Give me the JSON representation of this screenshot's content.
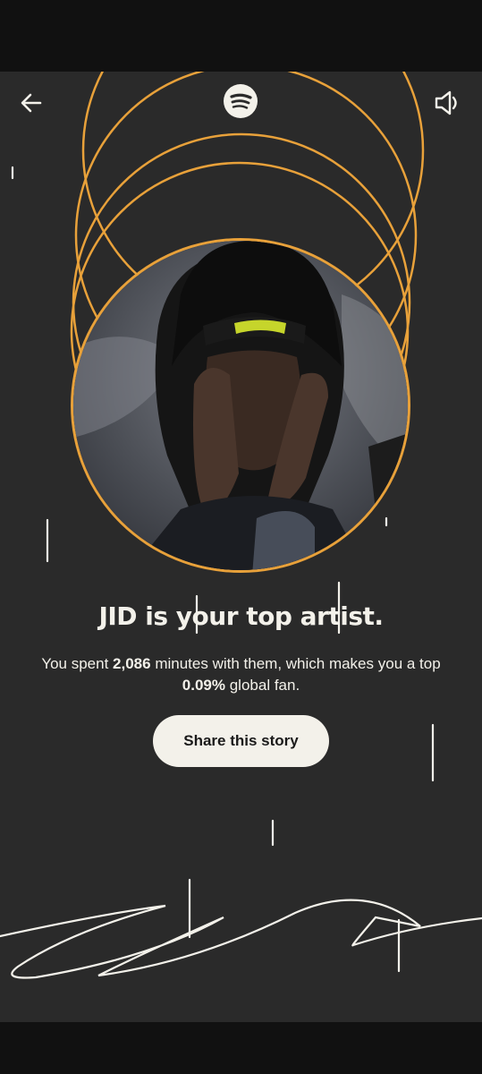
{
  "story": {
    "headline": "JID is your top artist.",
    "summary_prefix": "You spent ",
    "minutes": "2,086",
    "summary_middle": " minutes with them, which makes you a top ",
    "percent": "0.09%",
    "summary_suffix": " global fan.",
    "share_label": "Share this story"
  },
  "icons": {
    "back": "arrow-left-icon",
    "logo": "spotify-logo-icon",
    "sound": "speaker-icon"
  },
  "colors": {
    "background": "#2a2a2a",
    "ring": "#e8a13a",
    "text": "#f3f1ea",
    "button_bg": "#f3f1ea"
  }
}
